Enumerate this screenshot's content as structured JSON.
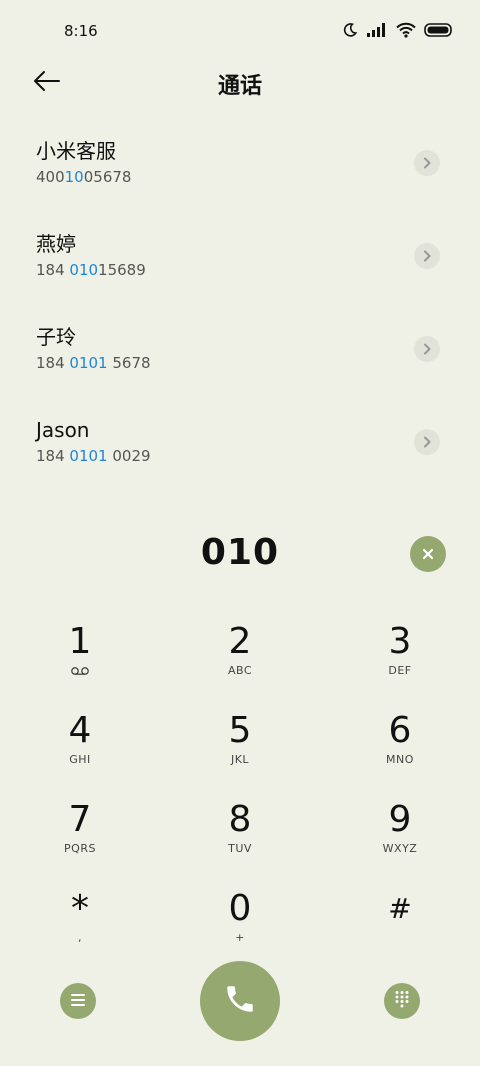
{
  "status_bar": {
    "time": "8:16",
    "icons": [
      "moon-icon",
      "signal-icon",
      "wifi-icon",
      "battery-icon"
    ]
  },
  "header": {
    "title": "通话",
    "back_icon": "arrow-left-icon"
  },
  "results": [
    {
      "name": "小米客服",
      "number_pre": "400",
      "number_match": "10",
      "number_post": "05678"
    },
    {
      "name": "燕婷",
      "number_pre": "184 ",
      "number_match": "010",
      "number_post": "15689"
    },
    {
      "name": "子玲",
      "number_pre": "184 ",
      "number_match": "0101",
      "number_post": " 5678"
    },
    {
      "name": "Jason",
      "number_pre": "184 ",
      "number_match": "0101",
      "number_post": " 0029"
    }
  ],
  "dialer": {
    "input_value": "010",
    "keys": [
      {
        "digit": "1",
        "letters": ""
      },
      {
        "digit": "2",
        "letters": "ABC"
      },
      {
        "digit": "3",
        "letters": "DEF"
      },
      {
        "digit": "4",
        "letters": "GHI"
      },
      {
        "digit": "5",
        "letters": "JKL"
      },
      {
        "digit": "6",
        "letters": "MNO"
      },
      {
        "digit": "7",
        "letters": "PQRS"
      },
      {
        "digit": "8",
        "letters": "TUV"
      },
      {
        "digit": "9",
        "letters": "WXYZ"
      },
      {
        "digit": "*",
        "letters": ","
      },
      {
        "digit": "0",
        "letters": "+"
      },
      {
        "digit": "#",
        "letters": ""
      }
    ]
  },
  "colors": {
    "background": "#f0f1e6",
    "accent": "#94a86f",
    "highlight": "#1f86d6"
  }
}
